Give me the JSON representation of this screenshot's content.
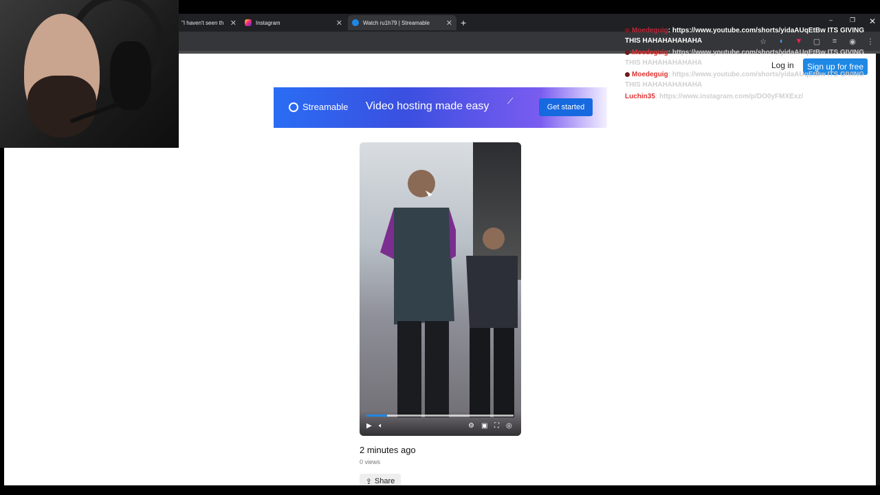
{
  "tabs": [
    {
      "title": "\"I haven't seen th",
      "close": "✕"
    },
    {
      "title": "Instagram",
      "close": "✕"
    },
    {
      "title": "Watch ru1h79 | Streamable",
      "close": "✕"
    }
  ],
  "new_tab": "+",
  "window_close": "✕",
  "page": {
    "login": "Log in",
    "signup": "Sign up for free",
    "banner": {
      "brand": "Streamable",
      "tagline": "Video hosting made easy",
      "cta": "Get started"
    },
    "video": {
      "progress": 0.14
    },
    "posted": "2 minutes ago",
    "views": "0 views",
    "share": "Share"
  },
  "chat": [
    {
      "name": "Moedeguig",
      "text": ": https://www.youtube.com/shorts/yidaAUqEtBw ITS GIVING THIS HAHAHAHAHAHA"
    },
    {
      "name": "Moedeguig",
      "text": ": https://www.youtube.com/shorts/yidaAUqEtBw ITS GIVING THIS HAHAHAHAHAHA"
    },
    {
      "name": "Moedeguig",
      "text": ": https://www.youtube.com/shorts/yidaAUqEtBw ITS GIVING THIS HAHAHAHAHAHA"
    },
    {
      "name": "Luchin35",
      "text": ": https://www.instagram.com/p/DO0yFMXExz/"
    }
  ],
  "colors": {
    "accent": "#1e88e5",
    "chat_name": "#c0283a",
    "chat_name_alt": "#2b5fb8"
  }
}
